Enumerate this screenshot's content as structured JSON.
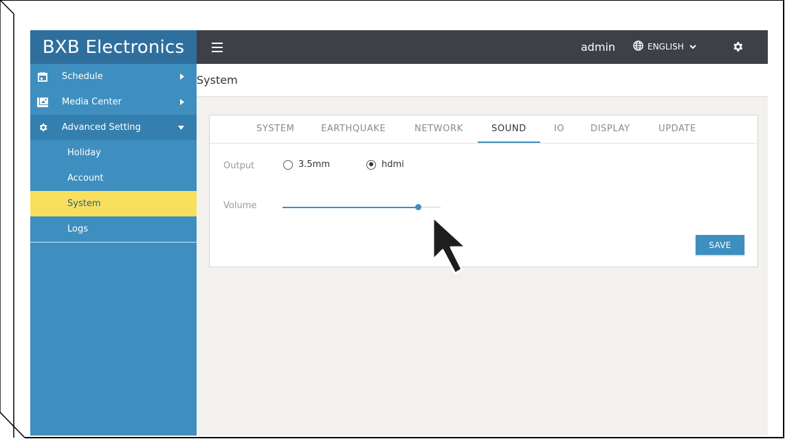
{
  "sidebar": {
    "brand": "BXB Electronics",
    "items": [
      {
        "label": "Schedule",
        "icon": "calendar-icon"
      },
      {
        "label": "Media Center",
        "icon": "photo-library-icon"
      },
      {
        "label": "Advanced Setting",
        "icon": "gear-icon"
      }
    ],
    "sub_items": [
      {
        "label": "Holiday"
      },
      {
        "label": "Account"
      },
      {
        "label": "System"
      },
      {
        "label": "Logs"
      }
    ],
    "selected_sub_item": "System"
  },
  "topbar": {
    "user": "admin",
    "language": "ENGLISH"
  },
  "page": {
    "title": "System"
  },
  "tabs": [
    {
      "label": "SYSTEM"
    },
    {
      "label": "EARTHQUAKE"
    },
    {
      "label": "NETWORK"
    },
    {
      "label": "SOUND"
    },
    {
      "label": "IO"
    },
    {
      "label": "DISPLAY"
    },
    {
      "label": "UPDATE"
    }
  ],
  "active_tab": "SOUND",
  "sound": {
    "output_label": "Output",
    "output_options": [
      "3.5mm",
      "hdmi"
    ],
    "output_selected": "hdmi",
    "volume_label": "Volume",
    "volume_level": 0.86,
    "save_label": "SAVE"
  },
  "colors": {
    "accent": "#3e8fbf",
    "brand_bar": "#2f6f9e",
    "topbar": "#3d4047",
    "selected_item": "#f8e05e",
    "content_bg": "#f2f1ee"
  }
}
